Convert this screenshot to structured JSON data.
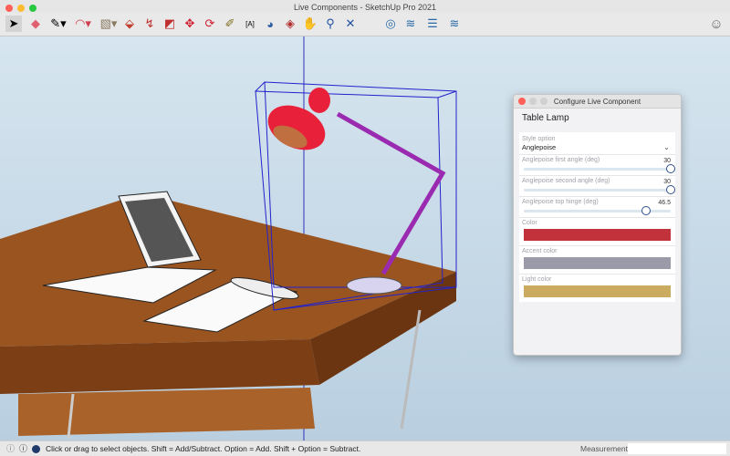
{
  "window": {
    "title": "Live Components - SketchUp Pro 2021"
  },
  "toolbar": {
    "tools": [
      "select",
      "eraser",
      "pencil-line",
      "arc",
      "shape",
      "push-pull",
      "follow-me",
      "offset",
      "move",
      "rotate",
      "tape-measure",
      "text",
      "paint-bucket",
      "orbit",
      "pan",
      "zoom",
      "zoom-extents",
      "extension-warehouse",
      "3d-warehouse",
      "layers",
      "scenes"
    ]
  },
  "dialog": {
    "title": "Configure Live Component",
    "heading": "Table Lamp",
    "style_option": {
      "label": "Style option",
      "value": "Anglepoise"
    },
    "sliders": [
      {
        "label": "Anglepoise first angle (deg)",
        "value": "30",
        "fraction": 1.0
      },
      {
        "label": "Anglepoise second angle (deg)",
        "value": "30",
        "fraction": 1.0
      },
      {
        "label": "Anglepoise top hinge (deg)",
        "value": "46.5",
        "fraction": 0.83
      }
    ],
    "colors": [
      {
        "label": "Color",
        "hex": "#c1323b"
      },
      {
        "label": "Accent color",
        "hex": "#9b9aa9"
      },
      {
        "label": "Light color",
        "hex": "#cbab5f"
      }
    ]
  },
  "status": {
    "message": "Click or drag to select objects. Shift = Add/Subtract. Option = Add. Shift + Option = Subtract.",
    "measurements_label": "Measurements",
    "measurements_value": ""
  }
}
